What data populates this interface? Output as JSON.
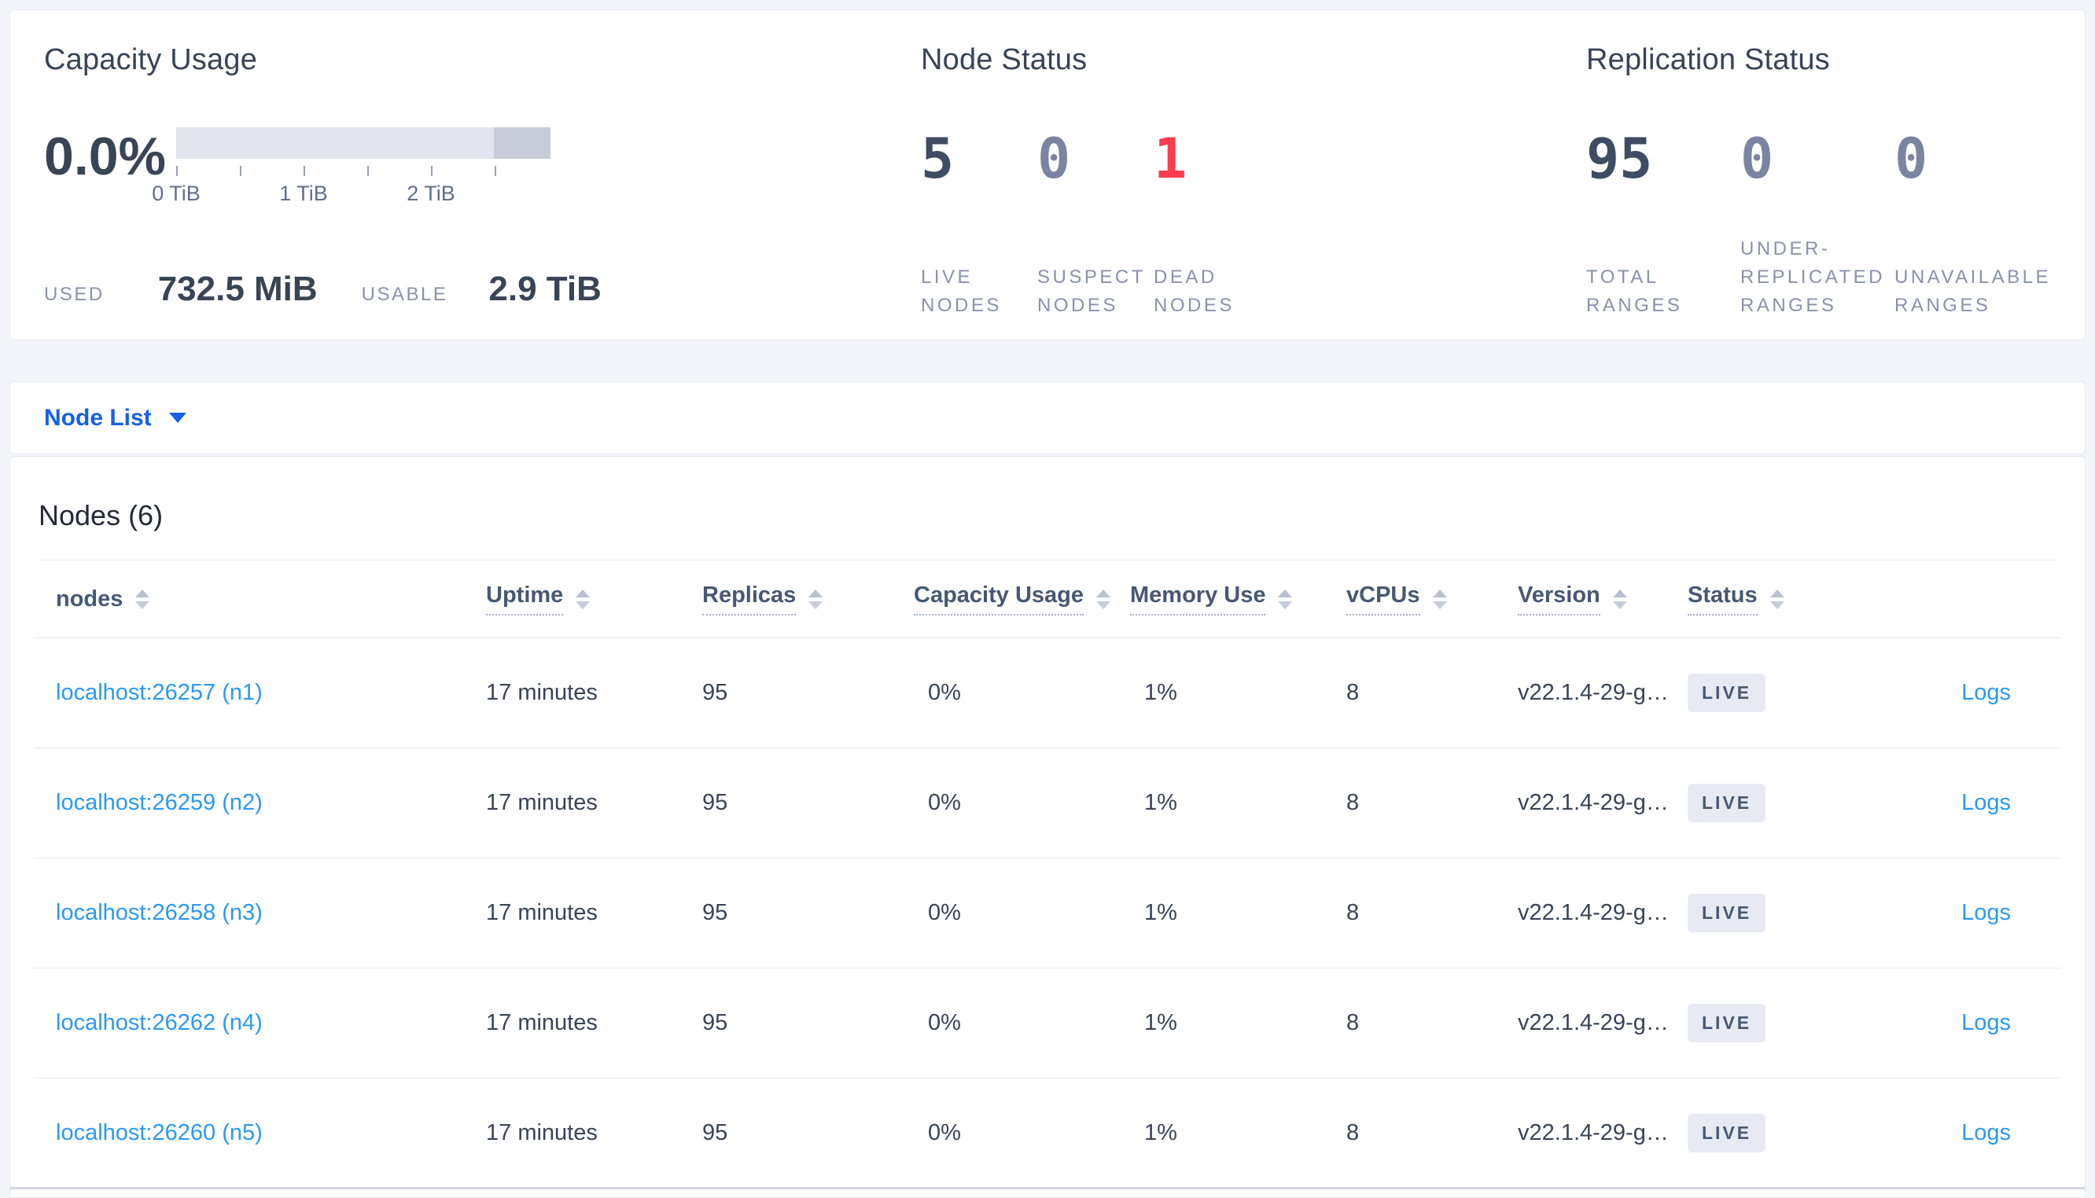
{
  "colors": {
    "title": "#394455",
    "stat_dark": "#3f4c63",
    "stat_muted": "#7b84a1",
    "stat_red": "#ff3b4e",
    "label_gray": "#8a92a9",
    "link": "#2b99f2",
    "accent_blue": "#1460e8",
    "badge_bg": "#e7eaf2",
    "badge_text": "#475872",
    "bar_light": "#e3e5ef",
    "bar_dark": "#c8ccd9"
  },
  "capacity": {
    "title": "Capacity Usage",
    "percent": "0.0%",
    "axis_ticks": [
      "0 TiB",
      "1 TiB",
      "2 TiB"
    ],
    "used_label": "USED",
    "used_value": "732.5 MiB",
    "usable_label": "USABLE",
    "usable_value": "2.9 TiB"
  },
  "node_status": {
    "title": "Node Status",
    "stats": [
      {
        "value": "5",
        "label": "LIVE NODES"
      },
      {
        "value": "0",
        "label": "SUSPECT NODES"
      },
      {
        "value": "1",
        "label": "DEAD NODES"
      }
    ]
  },
  "replication_status": {
    "title": "Replication Status",
    "stats": [
      {
        "value": "95",
        "label": "TOTAL RANGES"
      },
      {
        "value": "0",
        "label": "UNDER-REPLICATED RANGES"
      },
      {
        "value": "0",
        "label": "UNAVAILABLE RANGES"
      }
    ]
  },
  "node_list_bar": {
    "label": "Node List"
  },
  "nodes_section": {
    "title": "Nodes (6)",
    "columns": [
      {
        "label": "nodes"
      },
      {
        "label": "Uptime"
      },
      {
        "label": "Replicas"
      },
      {
        "label": "Capacity Usage"
      },
      {
        "label": "Memory Use"
      },
      {
        "label": "vCPUs"
      },
      {
        "label": "Version"
      },
      {
        "label": "Status"
      }
    ],
    "rows": [
      {
        "node": "localhost:26257 (n1)",
        "uptime": "17 minutes",
        "replicas": "95",
        "capacity_usage": "0%",
        "memory_use": "1%",
        "vcpus": "8",
        "version": "v22.1.4-29-g…",
        "status": "LIVE",
        "logs": "Logs"
      },
      {
        "node": "localhost:26259 (n2)",
        "uptime": "17 minutes",
        "replicas": "95",
        "capacity_usage": "0%",
        "memory_use": "1%",
        "vcpus": "8",
        "version": "v22.1.4-29-g…",
        "status": "LIVE",
        "logs": "Logs"
      },
      {
        "node": "localhost:26258 (n3)",
        "uptime": "17 minutes",
        "replicas": "95",
        "capacity_usage": "0%",
        "memory_use": "1%",
        "vcpus": "8",
        "version": "v22.1.4-29-g…",
        "status": "LIVE",
        "logs": "Logs"
      },
      {
        "node": "localhost:26262 (n4)",
        "uptime": "17 minutes",
        "replicas": "95",
        "capacity_usage": "0%",
        "memory_use": "1%",
        "vcpus": "8",
        "version": "v22.1.4-29-g…",
        "status": "LIVE",
        "logs": "Logs"
      },
      {
        "node": "localhost:26260 (n5)",
        "uptime": "17 minutes",
        "replicas": "95",
        "capacity_usage": "0%",
        "memory_use": "1%",
        "vcpus": "8",
        "version": "v22.1.4-29-g…",
        "status": "LIVE",
        "logs": "Logs"
      }
    ]
  }
}
